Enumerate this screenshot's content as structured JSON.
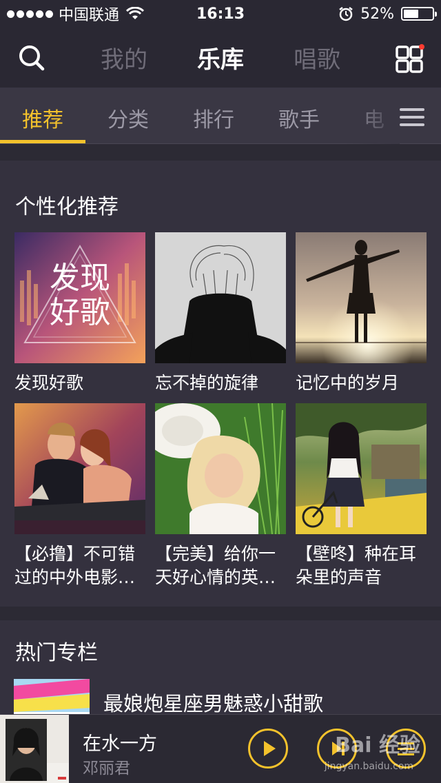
{
  "status_bar": {
    "carrier": "中国联通",
    "time": "16:13",
    "battery": "52%",
    "battery_level": 0.52
  },
  "top_nav": {
    "tabs": [
      {
        "label": "我的",
        "active": false
      },
      {
        "label": "乐库",
        "active": true
      },
      {
        "label": "唱歌",
        "active": false
      }
    ]
  },
  "sub_nav": {
    "tabs": [
      {
        "label": "推荐",
        "active": true
      },
      {
        "label": "分类",
        "active": false
      },
      {
        "label": "排行",
        "active": false
      },
      {
        "label": "歌手",
        "active": false
      },
      {
        "label": "电",
        "active": false
      }
    ]
  },
  "personalized": {
    "title": "个性化推荐",
    "cards": [
      {
        "caption": "发现好歌",
        "art_text": "发现\n好歌"
      },
      {
        "caption": "忘不掉的旋律"
      },
      {
        "caption": "记忆中的岁月"
      },
      {
        "caption": "【必撸】不可错过的中外电影…"
      },
      {
        "caption": "【完美】给你一天好心情的英…"
      },
      {
        "caption": "【壁咚】种在耳朵里的声音"
      }
    ]
  },
  "hot_column": {
    "title": "热门专栏",
    "item_title": "最娘炮星座男魅惑小甜歌"
  },
  "player": {
    "song": "在水一方",
    "artist": "邓丽君"
  },
  "watermark": {
    "brand": "Bai 经验",
    "url": "jingyan.baidu.com"
  },
  "colors": {
    "accent": "#f4c22c",
    "notification_dot": "#ff3b30"
  }
}
